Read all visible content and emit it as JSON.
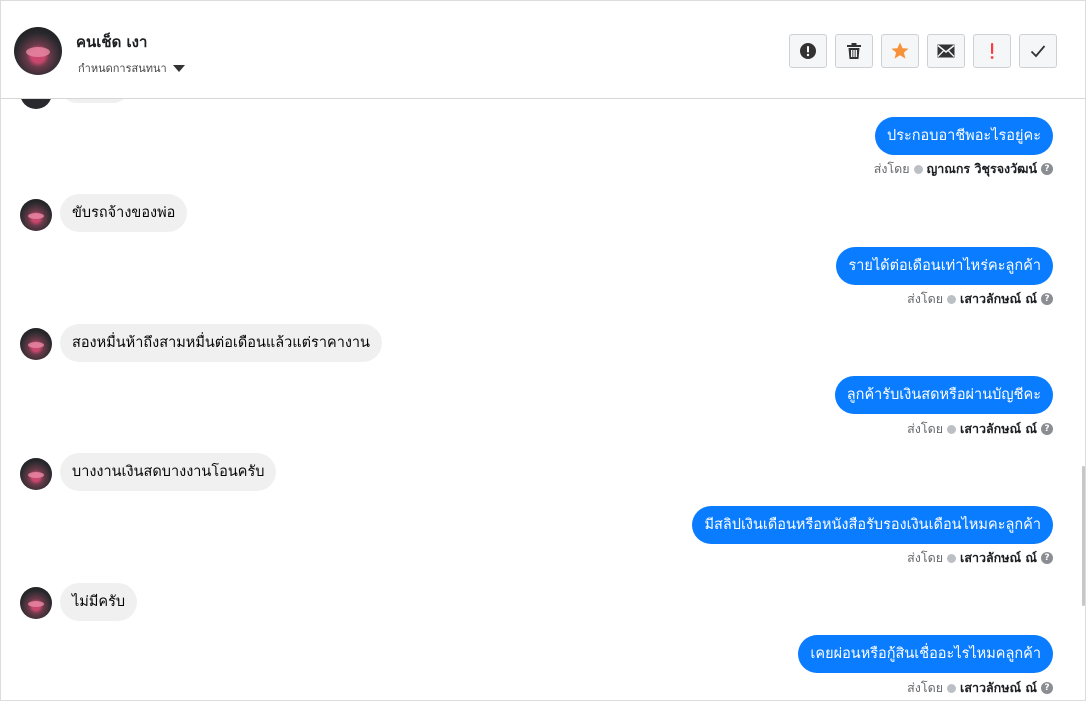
{
  "header": {
    "contact_name": "คนเช็ด เงา",
    "subtitle": "กำหนดการสนทนา",
    "actions": [
      {
        "name": "report-button",
        "icon": "exclamation-circle-icon"
      },
      {
        "name": "delete-button",
        "icon": "trash-icon"
      },
      {
        "name": "star-button",
        "icon": "star-icon",
        "color": "#f7923a"
      },
      {
        "name": "email-button",
        "icon": "envelope-icon"
      },
      {
        "name": "important-button",
        "icon": "exclamation-icon",
        "color": "#fa3e3e"
      },
      {
        "name": "done-button",
        "icon": "check-icon"
      }
    ]
  },
  "sent_by_label": "ส่งโดย",
  "messages": [
    {
      "dir": "out",
      "text": "ประกอบอาชีพอะไรอยู่คะ",
      "sender": "ญาณกร วิชุรจงวัฒน์"
    },
    {
      "dir": "in",
      "text": "ขับรถจ้างของพ่อ"
    },
    {
      "dir": "out",
      "text": "รายได้ต่อเดือนเท่าไหร่คะลูกค้า",
      "sender": "เสาวลักษณ์ ณ์"
    },
    {
      "dir": "in",
      "text": "สองหมื่นห้าถึงสามหมื่นต่อเดือนแล้วแต่ราคางาน"
    },
    {
      "dir": "out",
      "text": "ลูกค้ารับเงินสดหรือผ่านบัญชีคะ",
      "sender": "เสาวลักษณ์ ณ์"
    },
    {
      "dir": "in",
      "text": "บางงานเงินสดบางงานโอนครับ"
    },
    {
      "dir": "out",
      "text": "มีสลิปเงินเดือนหรือหนังสือรับรองเงินเดือนไหมคะลูกค้า",
      "sender": "เสาวลักษณ์ ณ์"
    },
    {
      "dir": "in",
      "text": "ไม่มีครับ"
    },
    {
      "dir": "out",
      "text": "เคยผ่อนหรือกู้สินเชื่ออะไรไหมคลูกค้า",
      "sender": "เสาวลักษณ์ ณ์"
    }
  ],
  "colors": {
    "outgoing_bubble": "#0a7cff",
    "incoming_bubble": "#f0f0f0"
  }
}
